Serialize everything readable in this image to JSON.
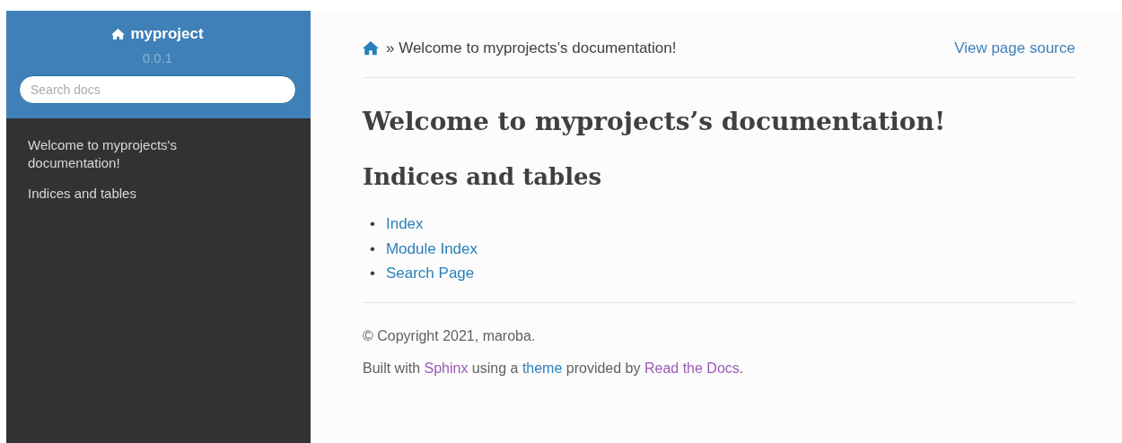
{
  "sidebar": {
    "project": "myproject",
    "version": "0.0.1",
    "search": {
      "placeholder": "Search docs"
    },
    "items": [
      {
        "label": "Welcome to myprojects's documentation!"
      },
      {
        "label": "Indices and tables"
      }
    ]
  },
  "breadcrumb": {
    "current": "» Welcome to myprojects’s documentation!"
  },
  "view_source": "View page source",
  "title": "Welcome to myprojects’s documentation!",
  "section": "Indices and tables",
  "links": [
    {
      "bullet": "•",
      "text": "Index"
    },
    {
      "bullet": "•",
      "text": "Module Index"
    },
    {
      "bullet": "•",
      "text": "Search Page"
    }
  ],
  "footer": {
    "copyright": "© Copyright 2021, maroba.",
    "built": [
      {
        "kind": "text",
        "text": "Built with "
      },
      {
        "kind": "link",
        "text": "Sphinx",
        "visited": true
      },
      {
        "kind": "text",
        "text": " using a "
      },
      {
        "kind": "link",
        "text": "theme",
        "visited": false
      },
      {
        "kind": "text",
        "text": " provided by "
      },
      {
        "kind": "link",
        "text": "Read the Docs",
        "visited": true
      },
      {
        "kind": "text",
        "text": "."
      }
    ]
  }
}
